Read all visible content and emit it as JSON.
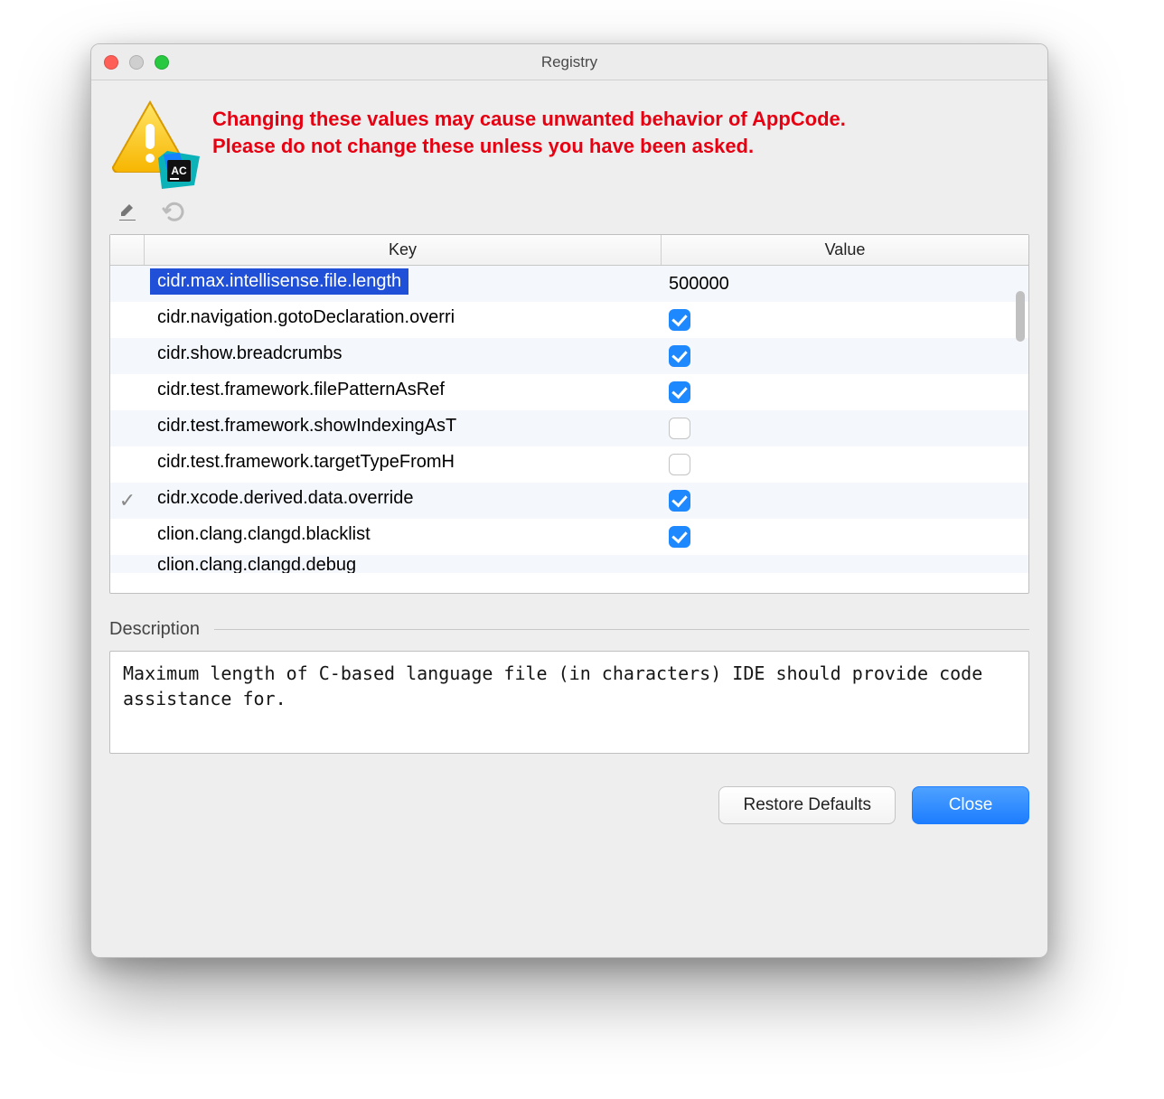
{
  "title": "Registry",
  "warning_line1": "Changing these values may cause unwanted behavior of AppCode.",
  "warning_line2": "Please do not change these unless you have been asked.",
  "app_badge": "AC",
  "columns": {
    "key": "Key",
    "value": "Value"
  },
  "rows": [
    {
      "modified": "",
      "key": "cidr.max.intellisense.file.length",
      "value": "500000",
      "type": "text",
      "selected": true
    },
    {
      "modified": "",
      "key": "cidr.navigation.gotoDeclaration.overri",
      "type": "check",
      "checked": true
    },
    {
      "modified": "",
      "key": "cidr.show.breadcrumbs",
      "type": "check",
      "checked": true
    },
    {
      "modified": "",
      "key": "cidr.test.framework.filePatternAsRef",
      "type": "check",
      "checked": true
    },
    {
      "modified": "",
      "key": "cidr.test.framework.showIndexingAsT",
      "type": "check",
      "checked": false
    },
    {
      "modified": "",
      "key": "cidr.test.framework.targetTypeFromH",
      "type": "check",
      "checked": false
    },
    {
      "modified": "✓",
      "key": "cidr.xcode.derived.data.override",
      "type": "check",
      "checked": true
    },
    {
      "modified": "",
      "key": "clion.clang.clangd.blacklist",
      "type": "check",
      "checked": true
    },
    {
      "modified": "",
      "key": "clion.clang.clangd.debug",
      "type": "check",
      "checked": false
    }
  ],
  "description_label": "Description",
  "description_text": "Maximum length of C-based language file (in characters) IDE should provide code assistance for.",
  "buttons": {
    "restore": "Restore Defaults",
    "close": "Close"
  }
}
